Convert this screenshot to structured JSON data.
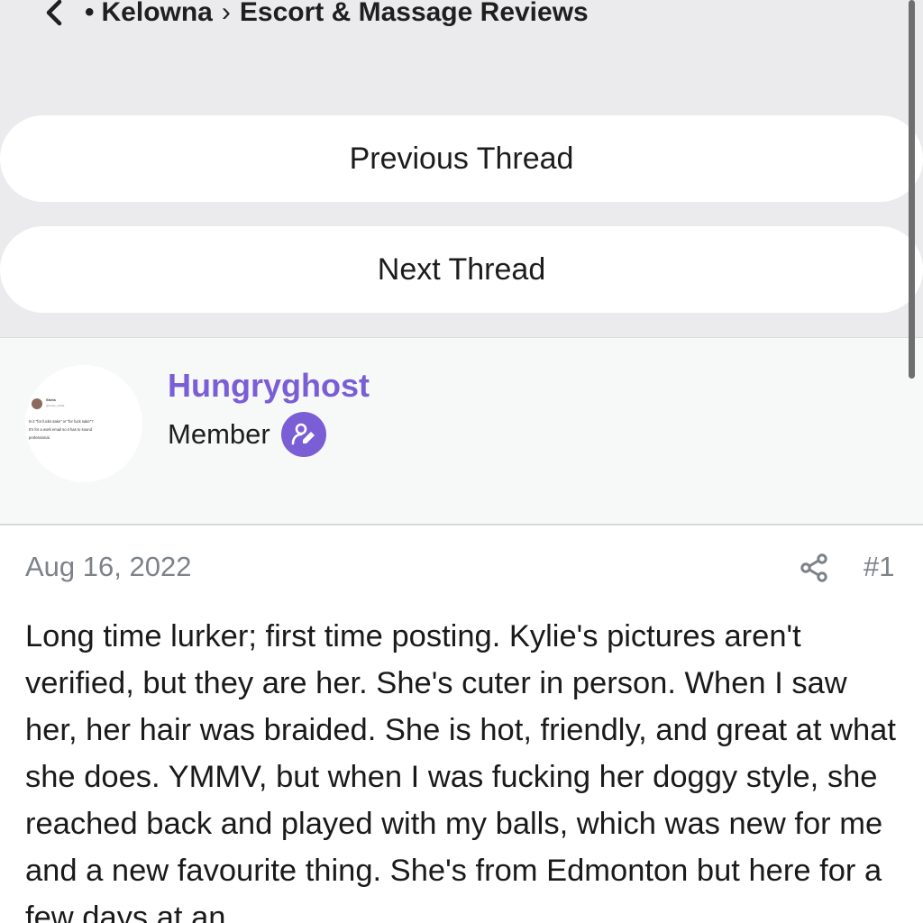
{
  "header": {
    "breadcrumb_bullet": "•",
    "breadcrumb_parent": "Kelowna",
    "breadcrumb_separator": "›",
    "breadcrumb_current": "Escort & Massage Reviews"
  },
  "nav": {
    "previous_label": "Previous Thread",
    "next_label": "Next Thread"
  },
  "author": {
    "username": "Hungryghost",
    "role": "Member"
  },
  "avatar_tweet": {
    "name": "Shela",
    "handle": "@Chelo_FADE",
    "line1": "Is it \"for fucks sake\" or \"for fuck sake\"?",
    "line2": "It's for a work email so it has to sound",
    "line3": "professional."
  },
  "post": {
    "date": "Aug 16, 2022",
    "number": "#1",
    "body": "Long time lurker; first time posting. Kylie's pictures aren't verified, but they are her. She's cuter in person. When I saw her, her hair was braided. She is hot, friendly, and great at what she does. YMMV, but when I was fucking her doggy style, she reached back and played with my balls, which was new for me and a new favourite thing. She's from Edmonton but here for a few days at an"
  },
  "colors": {
    "accent": "#7a5ed6",
    "header_bg": "#ebebed",
    "author_bg": "#f7f8f8",
    "meta_text": "#7d8289"
  },
  "icons": {
    "back": "chevron-left-icon",
    "badge": "user-edit-icon",
    "share": "share-icon"
  }
}
